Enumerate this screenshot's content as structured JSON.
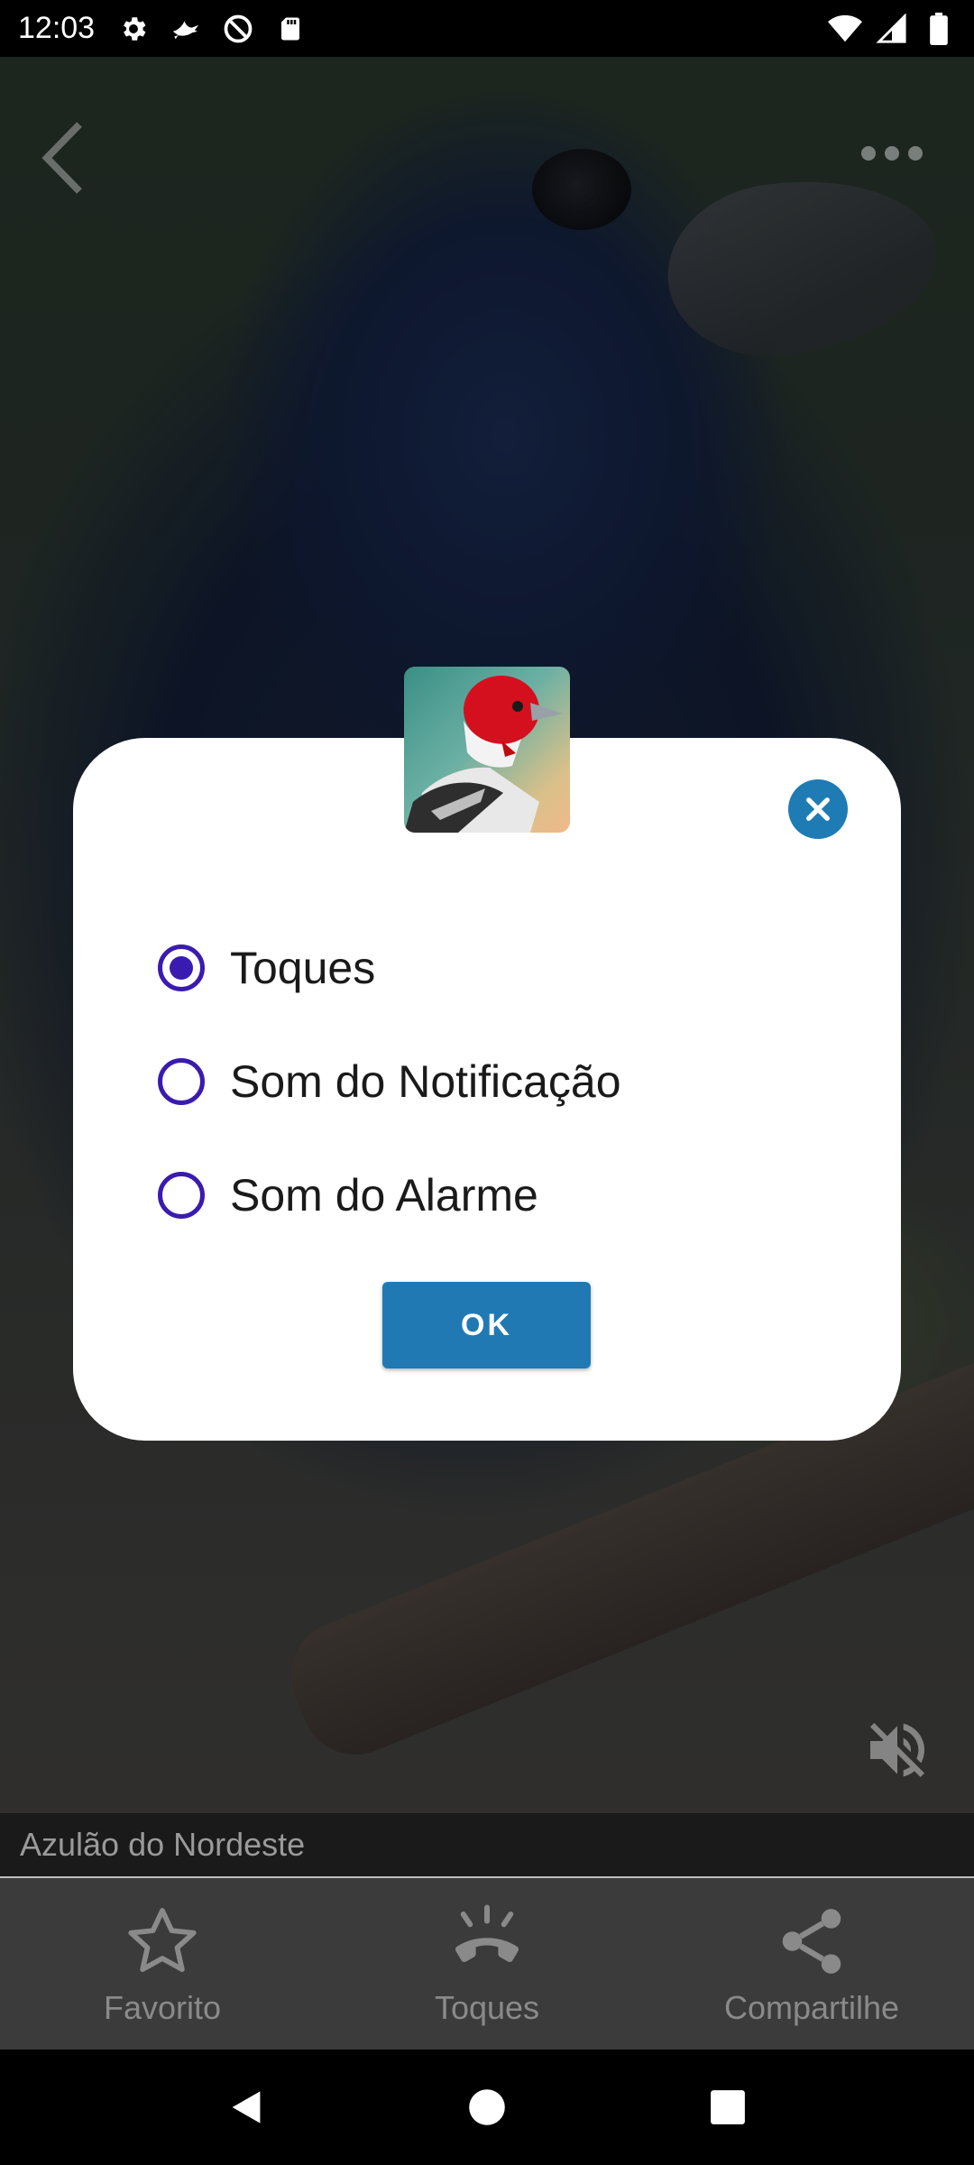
{
  "status_bar": {
    "time": "12:03",
    "left_icons": [
      "gear-icon",
      "bird-flying-icon",
      "do-not-disturb-icon",
      "sd-card-icon"
    ],
    "right_icons": [
      "wifi-icon",
      "signal-icon",
      "battery-icon"
    ]
  },
  "header": {
    "back_icon": "chevron-left-icon",
    "more_icon": "more-dots-icon"
  },
  "player": {
    "mute_icon": "volume-off-icon"
  },
  "sound": {
    "title": "Azulão do Nordeste"
  },
  "actions": [
    {
      "label": "Favorito",
      "icon": "star-outline-icon"
    },
    {
      "label": "Toques",
      "icon": "ringtone-icon"
    },
    {
      "label": "Compartilhe",
      "icon": "share-icon"
    }
  ],
  "dialog": {
    "options": [
      {
        "label": "Toques",
        "selected": true
      },
      {
        "label": "Som do Notificação",
        "selected": false
      },
      {
        "label": "Som do Alarme",
        "selected": false
      }
    ],
    "ok_label": "OK",
    "close_icon": "close-icon",
    "app_icon": "cardinal-bird-icon"
  },
  "nav_bar": {
    "back_icon": "nav-back-icon",
    "home_icon": "nav-home-icon",
    "recents_icon": "nav-recents-icon"
  },
  "colors": {
    "accent": "#2179b4",
    "radio": "#3a1bb0",
    "close": "#1f7bb3"
  }
}
